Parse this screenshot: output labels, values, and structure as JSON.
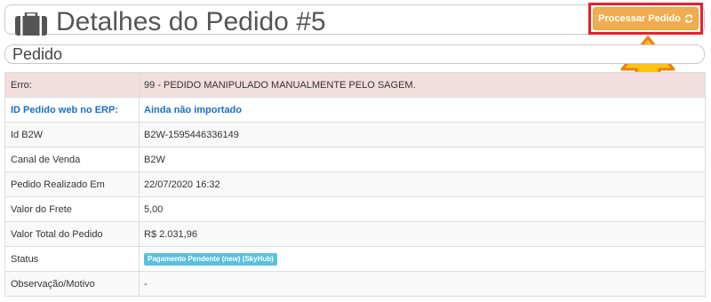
{
  "header": {
    "title": "Detalhes do Pedido #5",
    "process_button_label": "Processar Pedido",
    "icons": {
      "title_icon": "briefcase-icon",
      "button_icon": "refresh-icon"
    }
  },
  "section": {
    "title": "Pedido"
  },
  "rows": [
    {
      "label": "Erro:",
      "value": "99 - PEDIDO MANIPULADO MANUALMENTE PELO SAGEM."
    },
    {
      "label": "ID Pedido web no ERP:",
      "value": "Ainda não importado"
    },
    {
      "label": "Id B2W",
      "value": "B2W-1595446336149"
    },
    {
      "label": "Canal de Venda",
      "value": "B2W"
    },
    {
      "label": "Pedido Realizado Em",
      "value": "22/07/2020 16:32"
    },
    {
      "label": "Valor do Frete",
      "value": "5,00"
    },
    {
      "label": "Valor Total do Pedido",
      "value": "R$ 2.031,96"
    },
    {
      "label": "Status",
      "value": "Pagamento Pendente (new) (SkyHub)"
    },
    {
      "label": "Observação/Motivo",
      "value": "-"
    }
  ],
  "colors": {
    "button_bg": "#f0ad4e",
    "highlight_border": "#e8202a",
    "arrow_fill": "#ffc20e",
    "arrow_stroke": "#f07d16",
    "error_row_bg": "#f2dede",
    "erp_text": "#1a6fc4",
    "status_badge_bg": "#5bc0de"
  }
}
